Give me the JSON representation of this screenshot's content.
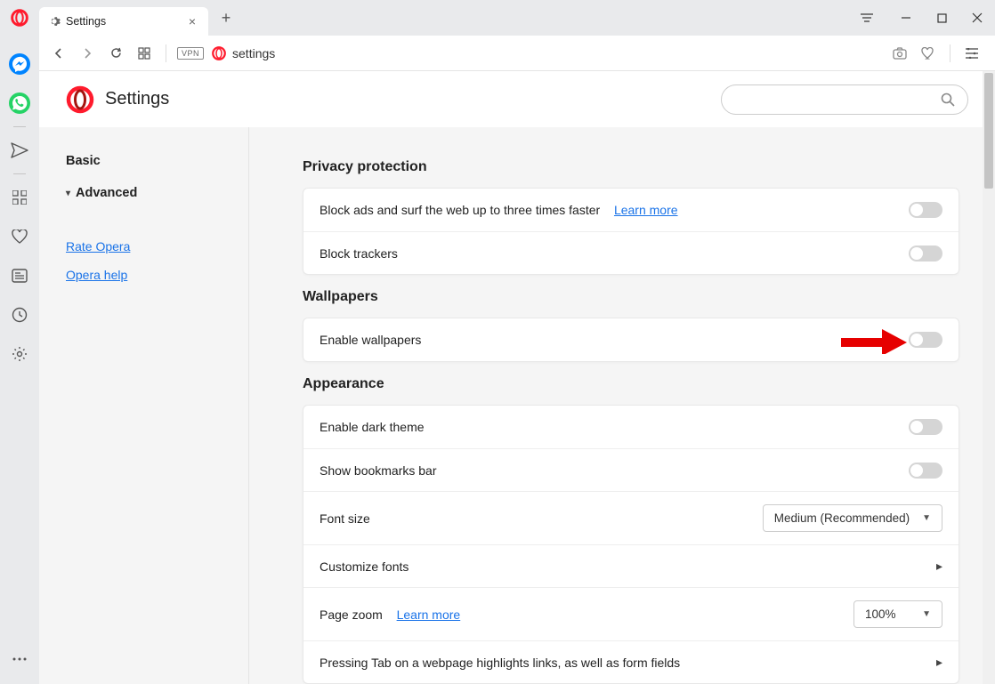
{
  "tab": {
    "title": "Settings"
  },
  "address": "settings",
  "vpn_label": "VPN",
  "page": {
    "title": "Settings"
  },
  "search": {
    "placeholder": ""
  },
  "nav": {
    "basic": "Basic",
    "advanced": "Advanced",
    "rate": "Rate Opera",
    "help": "Opera help"
  },
  "sections": {
    "privacy": {
      "title": "Privacy protection",
      "block_ads": "Block ads and surf the web up to three times faster",
      "learn_more": "Learn more",
      "block_trackers": "Block trackers"
    },
    "wallpapers": {
      "title": "Wallpapers",
      "enable": "Enable wallpapers"
    },
    "appearance": {
      "title": "Appearance",
      "dark_theme": "Enable dark theme",
      "bookmarks_bar": "Show bookmarks bar",
      "font_size": "Font size",
      "font_size_value": "Medium (Recommended)",
      "customize_fonts": "Customize fonts",
      "page_zoom": "Page zoom",
      "page_zoom_learn": "Learn more",
      "page_zoom_value": "100%",
      "tab_highlight": "Pressing Tab on a webpage highlights links, as well as form fields"
    }
  }
}
